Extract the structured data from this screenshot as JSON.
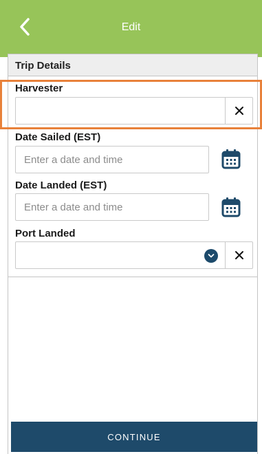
{
  "header": {
    "title": "Edit",
    "back_icon": "chevron-left-icon",
    "background_color": "#97c459"
  },
  "section": {
    "title": "Trip Details"
  },
  "fields": {
    "harvester": {
      "label": "Harvester",
      "value": "",
      "clear_icon": "close-icon"
    },
    "date_sailed": {
      "label": "Date Sailed (EST)",
      "placeholder": "Enter a date and time",
      "icon": "calendar-icon"
    },
    "date_landed": {
      "label": "Date Landed (EST)",
      "placeholder": "Enter a date and time",
      "icon": "calendar-icon"
    },
    "port_landed": {
      "label": "Port Landed",
      "value": "",
      "dropdown_icon": "chevron-down-icon",
      "clear_icon": "close-icon"
    }
  },
  "footer": {
    "continue_label": "CONTINUE",
    "button_color": "#1e4a6a"
  },
  "highlight_color": "#e8813a"
}
